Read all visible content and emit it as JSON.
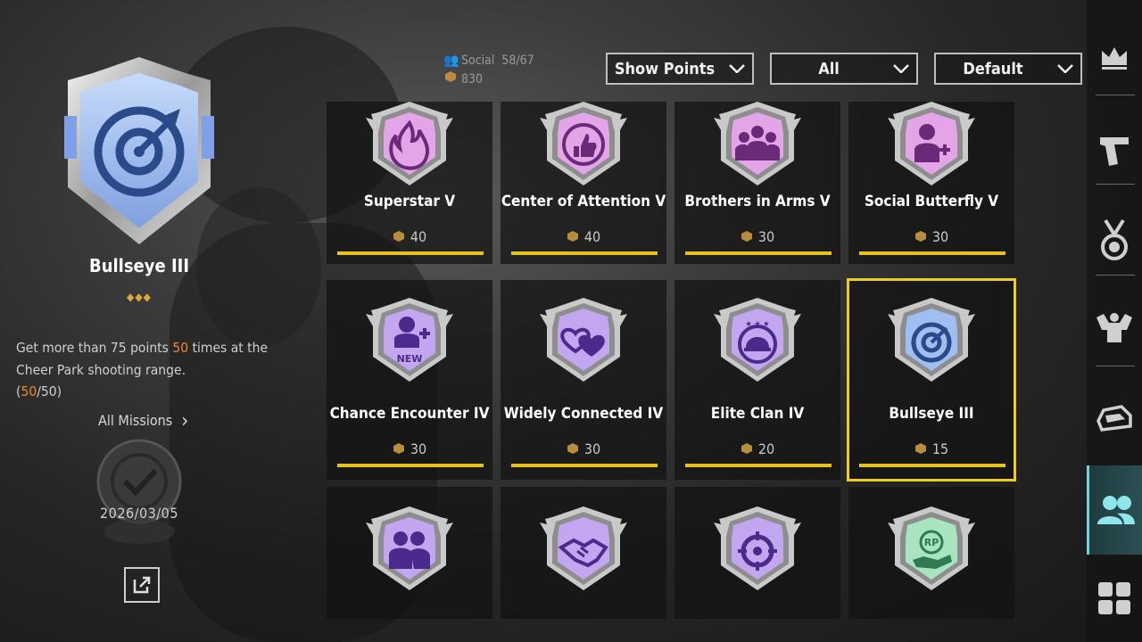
{
  "detail": {
    "title": "Bullseye III",
    "diamonds": "◆◆◆",
    "desc_before": "Get more than 75 points ",
    "desc_count": "50",
    "desc_after": " times at the Cheer Park shooting range.",
    "progress_open": "(",
    "progress_current": "50",
    "progress_total": "/50)",
    "all_missions": "All Missions",
    "date": "2026/03/05"
  },
  "stats": {
    "category": "Social",
    "progress": "58/67",
    "points": "830"
  },
  "filters": {
    "show": "Show Points",
    "type": "All",
    "sort": "Default"
  },
  "cards": [
    {
      "name": "Superstar V",
      "points": "40",
      "icon": "fire-icon"
    },
    {
      "name": "Center of Attention V",
      "points": "40",
      "icon": "thumbs-up-icon"
    },
    {
      "name": "Brothers in Arms V",
      "points": "30",
      "icon": "group-icon"
    },
    {
      "name": "Social Butterfly V",
      "points": "30",
      "icon": "add-friend-icon"
    },
    {
      "name": "Chance Encounter IV",
      "points": "30",
      "icon": "new-friend-icon"
    },
    {
      "name": "Widely Connected IV",
      "points": "30",
      "icon": "hearts-icon"
    },
    {
      "name": "Elite Clan IV",
      "points": "20",
      "icon": "clan-helmet-icon"
    },
    {
      "name": "Bullseye III",
      "points": "15",
      "icon": "target-icon"
    },
    {
      "name": "",
      "points": "",
      "icon": "duo-icon"
    },
    {
      "name": "",
      "points": "",
      "icon": "handshake-icon"
    },
    {
      "name": "",
      "points": "",
      "icon": "crosshair-icon"
    },
    {
      "name": "",
      "points": "",
      "icon": "rp-hand-icon"
    }
  ],
  "icon_new_label": "NEW",
  "icon_rp_label": "RP",
  "colors": {
    "accent_yellow": "#e6c31c",
    "highlight_orange": "#f08a2c",
    "badge_pink": "#d66fd0",
    "badge_purple": "#9a6fe0",
    "badge_blue": "#7fa6e8",
    "badge_green": "#8fd6a8",
    "rail_active": "#6fd6d8"
  },
  "rail": [
    "crown-icon",
    "pistol-icon",
    "medal-icon",
    "muscle-icon",
    "vehicle-icon",
    "friends-icon",
    "grid-icon"
  ]
}
